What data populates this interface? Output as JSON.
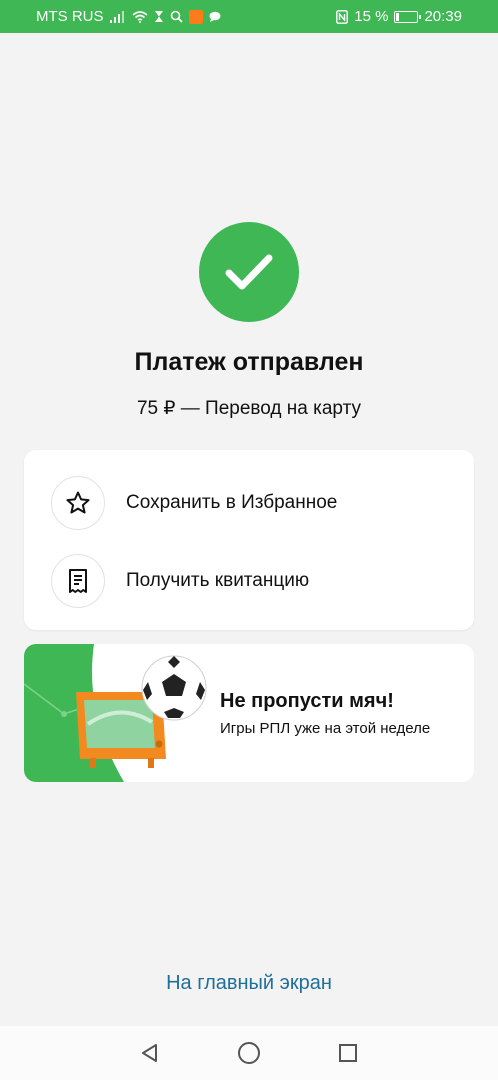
{
  "status_bar": {
    "carrier": "MTS RUS",
    "battery_percent": "15 %",
    "battery_level": 0.15,
    "time": "20:39",
    "background_color": "#3fb754",
    "icons": [
      "signal-icon",
      "wifi-icon",
      "hourglass-icon",
      "search-icon",
      "app-notification-icon",
      "chat-icon",
      "nfc-icon",
      "battery-icon"
    ]
  },
  "success": {
    "icon": "checkmark-icon",
    "accent_color": "#3fb754",
    "title": "Платеж отправлен",
    "subtitle": "75 ₽ — Перевод на карту"
  },
  "actions": [
    {
      "icon": "star-icon",
      "label": "Сохранить в Избранное"
    },
    {
      "icon": "receipt-icon",
      "label": "Получить квитанцию"
    }
  ],
  "promo": {
    "title": "Не пропусти мяч!",
    "text": "Игры РПЛ уже на этой неделе"
  },
  "footer": {
    "home_link": "На главный экран",
    "link_color": "#1f6f99"
  },
  "nav_bar": {
    "buttons": [
      "back-icon",
      "home-icon",
      "recents-icon"
    ]
  }
}
